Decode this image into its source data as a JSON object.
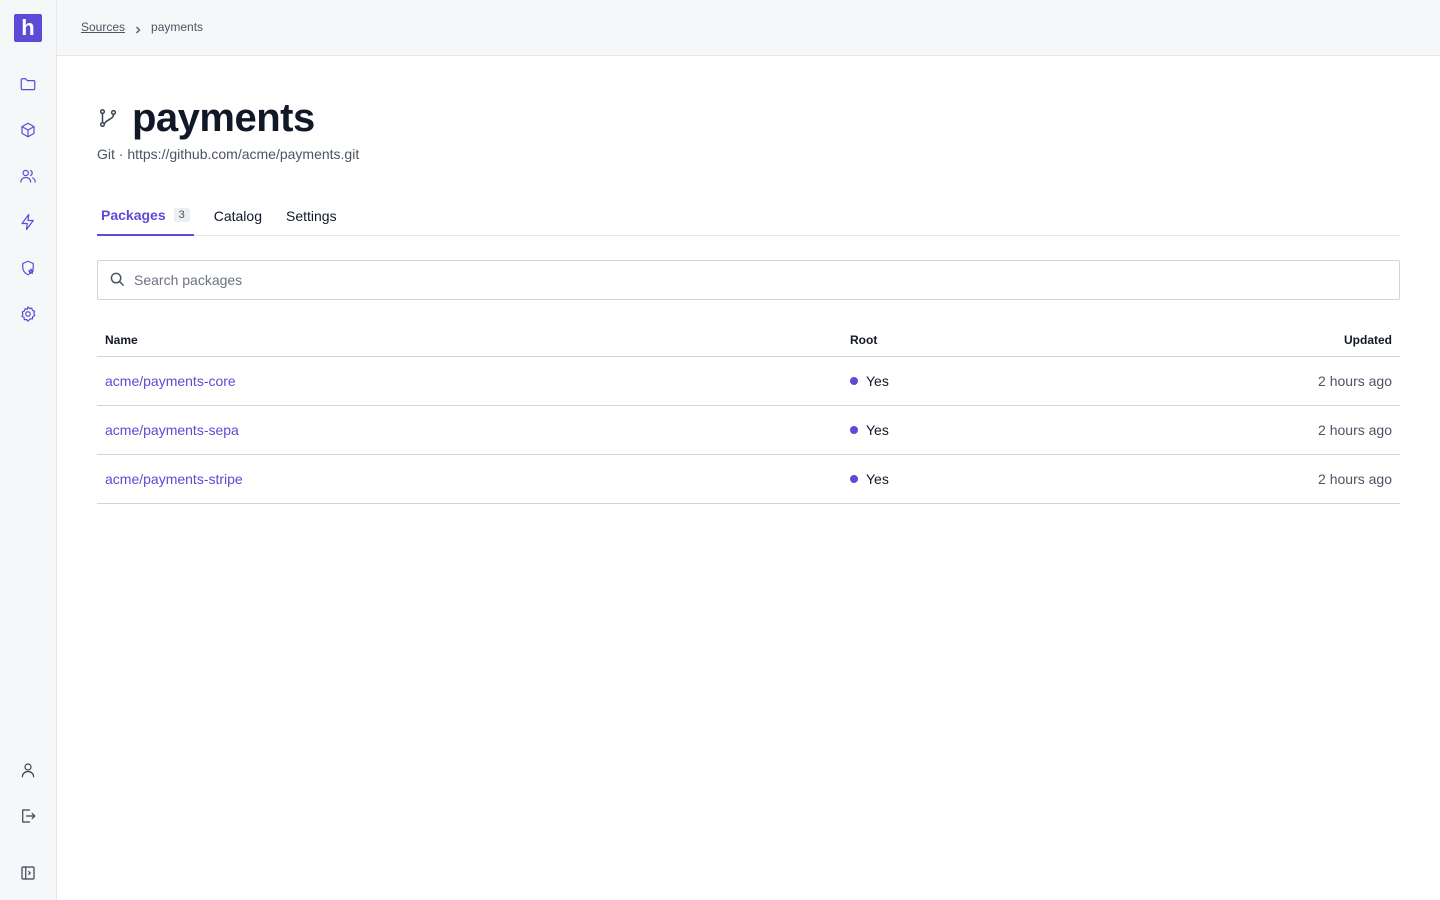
{
  "app": {
    "logo_letter": "h"
  },
  "sidebar": {
    "items": [
      "folder-icon",
      "package-icon",
      "users-icon",
      "bolt-icon",
      "shield-star-icon",
      "gear-icon"
    ],
    "bottom": [
      "user-icon",
      "logout-icon",
      "collapse-sidebar-icon"
    ]
  },
  "breadcrumb": {
    "parent": "Sources",
    "current": "payments"
  },
  "header": {
    "title": "payments",
    "subtitle": "Git · https://github.com/acme/payments.git"
  },
  "tabs": [
    {
      "label": "Packages",
      "count": "3",
      "active": true
    },
    {
      "label": "Catalog",
      "active": false
    },
    {
      "label": "Settings",
      "active": false
    }
  ],
  "search": {
    "placeholder": "Search packages",
    "value": ""
  },
  "table": {
    "columns": {
      "name": "Name",
      "root": "Root",
      "updated": "Updated"
    },
    "rows": [
      {
        "name": "acme/payments-core",
        "root": "Yes",
        "updated": "2 hours ago"
      },
      {
        "name": "acme/payments-sepa",
        "root": "Yes",
        "updated": "2 hours ago"
      },
      {
        "name": "acme/payments-stripe",
        "root": "Yes",
        "updated": "2 hours ago"
      }
    ]
  },
  "colors": {
    "accent": "#5b4bd6",
    "sidebar_bg": "#f6f7f9",
    "border": "#d1d5db"
  }
}
